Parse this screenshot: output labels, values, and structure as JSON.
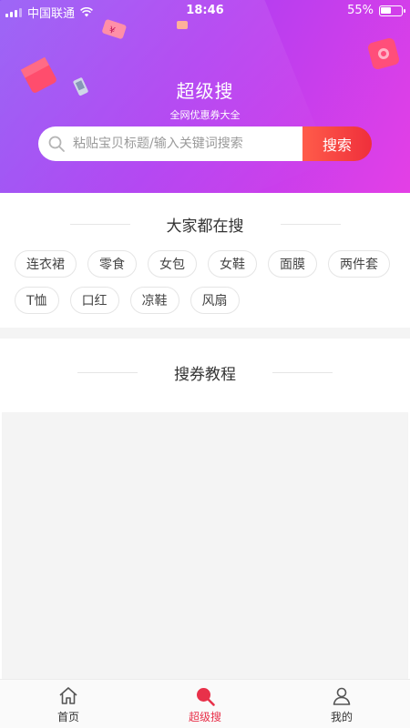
{
  "status_bar": {
    "carrier": "中国联通",
    "time": "18:46",
    "battery": "55%",
    "battery_level": 0.55
  },
  "header": {
    "title": "超级搜",
    "subtitle": "全网优惠券大全",
    "search_placeholder": "粘贴宝贝标题/输入关键词搜索",
    "search_button": "搜索"
  },
  "hot_searches": {
    "heading": "大家都在搜",
    "rows": [
      [
        "连衣裙",
        "零食",
        "女包",
        "女鞋",
        "面膜",
        "两件套"
      ],
      [
        "T恤",
        "口红",
        "凉鞋",
        "风扇"
      ]
    ]
  },
  "tutorial": {
    "heading": "搜券教程"
  },
  "tabbar": {
    "items": [
      {
        "label": "首页",
        "icon": "home-icon",
        "active": false
      },
      {
        "label": "超级搜",
        "icon": "search-magnifier-icon",
        "active": true
      },
      {
        "label": "我的",
        "icon": "user-icon",
        "active": false
      }
    ]
  },
  "colors": {
    "header_gradient_start": "#8a49f4",
    "header_gradient_end": "#e43fe6",
    "search_button": "#ef2f3b",
    "active_tab": "#e8314a"
  }
}
